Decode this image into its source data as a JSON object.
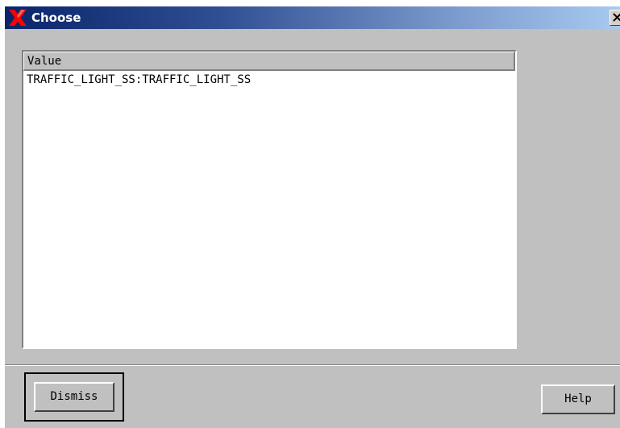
{
  "window": {
    "title": "Choose",
    "close_glyph": "✕"
  },
  "list": {
    "column_header": "Value",
    "items": [
      "TRAFFIC_LIGHT_SS:TRAFFIC_LIGHT_SS"
    ]
  },
  "buttons": {
    "dismiss_label": "Dismiss",
    "help_label": "Help"
  },
  "colors": {
    "titlebar_start": "#0a246a",
    "titlebar_end": "#a6caf0",
    "dialog_background": "#c0c0c0",
    "list_background": "#ffffff",
    "app_icon": "#ff0000"
  },
  "icons": {
    "app": "x-window-icon",
    "close": "close-icon"
  }
}
